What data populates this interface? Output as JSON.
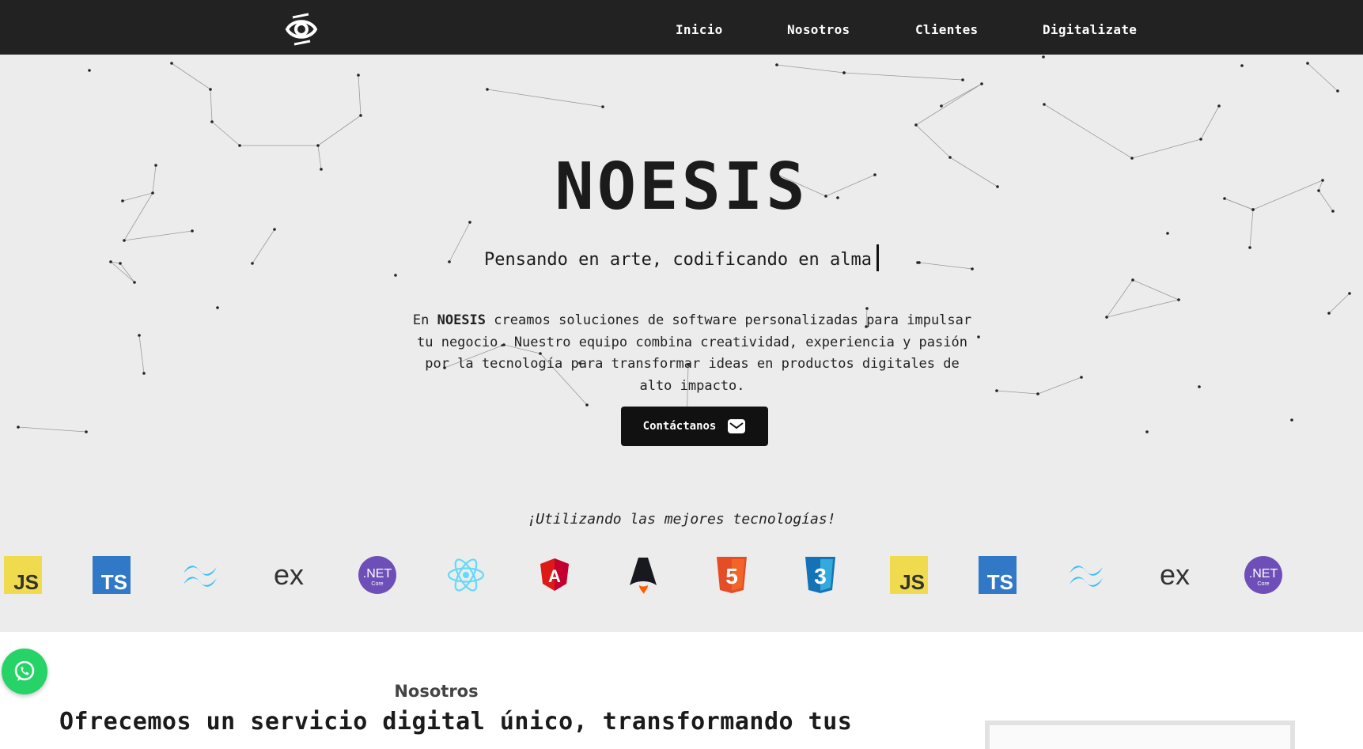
{
  "nav": {
    "logo_icon": "eye-logo-icon",
    "links": [
      "Inicio",
      "Nosotros",
      "Clientes",
      "Digitalizate"
    ]
  },
  "hero": {
    "title": "NOESIS",
    "subtitle": "Pensando en arte, codificando en alma",
    "description_intro": "En",
    "description_brand": "NOESIS",
    "description_rest": "creamos soluciones de software personalizadas para impulsar tu negocio. Nuestro equipo combina creatividad, experiencia y pasión por la tecnología para transformar ideas en productos digitales de alto impacto.",
    "cta_label": "Contáctanos",
    "cta_icon": "envelope-icon"
  },
  "technologies": {
    "caption": "¡Utilizando las mejores tecnologías!",
    "logos": [
      {
        "name": "javascript",
        "text": "JS",
        "color": "#f0db4f"
      },
      {
        "name": "typescript",
        "text": "TS",
        "color": "#3178c6"
      },
      {
        "name": "tailwind",
        "color": "#38bdf8"
      },
      {
        "name": "express",
        "text": "ex",
        "color": "#333333"
      },
      {
        "name": "dotnet-core",
        "text": ".NET",
        "subtext": "Core",
        "color": "#6e4fb8"
      },
      {
        "name": "react",
        "color": "#61dafb"
      },
      {
        "name": "angular",
        "text": "A",
        "color": "#dd1b16"
      },
      {
        "name": "astro",
        "color": "#17191e"
      },
      {
        "name": "html5",
        "text": "5",
        "color": "#e44d26"
      },
      {
        "name": "css3",
        "text": "3",
        "color": "#1572b6"
      },
      {
        "name": "javascript",
        "text": "JS",
        "color": "#f0db4f"
      },
      {
        "name": "typescript",
        "text": "TS",
        "color": "#3178c6"
      },
      {
        "name": "tailwind",
        "color": "#38bdf8"
      },
      {
        "name": "express",
        "text": "ex",
        "color": "#333333"
      },
      {
        "name": "dotnet-core",
        "text": ".NET",
        "subtext": "Core",
        "color": "#6e4fb8"
      }
    ]
  },
  "whatsapp": {
    "icon": "whatsapp-icon",
    "color": "#25d366"
  },
  "about": {
    "label": "Nosotros",
    "heading": "Ofrecemos un servicio digital único, transformando tus"
  },
  "colors": {
    "navbar": "#222222",
    "hero_bg": "#ececec",
    "accent": "#111111"
  }
}
